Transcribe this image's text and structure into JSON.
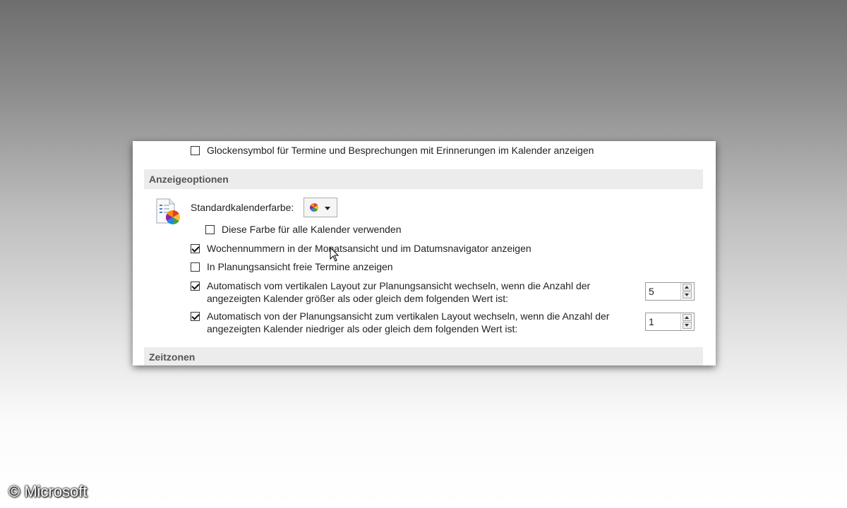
{
  "options": {
    "bell_reminder": {
      "label": "Glockensymbol für Termine und Besprechungen mit Erinnerungen im Kalender anzeigen",
      "checked": false
    },
    "display_section": {
      "title": "Anzeigeoptionen"
    },
    "default_color": {
      "label": "Standardkalenderfarbe:",
      "icon": "color-wheel-icon"
    },
    "use_color_all": {
      "label": "Diese Farbe für alle Kalender verwenden",
      "checked": false
    },
    "week_numbers": {
      "label": "Wochennummern in der Monatsansicht und im Datumsnavigator anzeigen",
      "checked": true
    },
    "free_appointments": {
      "label": "In Planungsansicht freie Termine anzeigen",
      "checked": false
    },
    "auto_switch_to_schedule": {
      "line1": "Automatisch vom vertikalen Layout zur Planungsansicht wechseln, wenn die Anzahl der",
      "line2": "angezeigten Kalender größer als oder gleich dem folgenden Wert ist:",
      "checked": true,
      "value": "5"
    },
    "auto_switch_to_vertical": {
      "line1": "Automatisch von der Planungsansicht zum vertikalen Layout wechseln, wenn die Anzahl der",
      "line2": "angezeigten Kalender niedriger als oder gleich dem folgenden Wert ist:",
      "checked": true,
      "value": "1"
    },
    "timezones_section": {
      "title": "Zeitzonen"
    }
  },
  "watermark": "© Microsoft"
}
